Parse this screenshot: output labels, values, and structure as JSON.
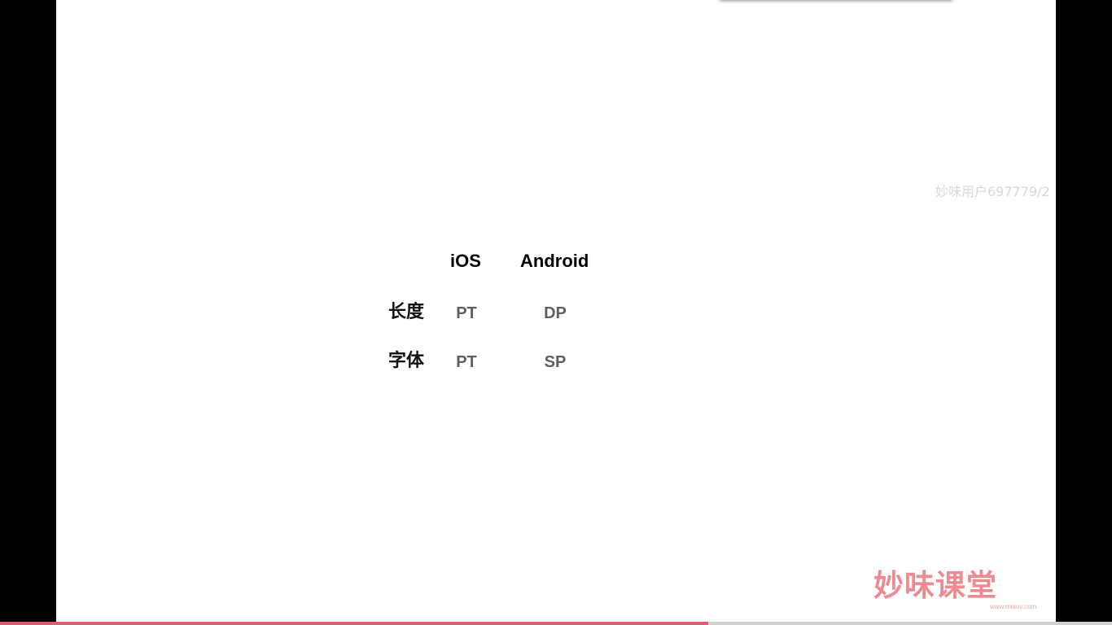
{
  "table": {
    "headers": [
      "iOS",
      "Android"
    ],
    "rows": [
      {
        "label": "长度",
        "ios": "PT",
        "android": "DP"
      },
      {
        "label": "字体",
        "ios": "PT",
        "android": "SP"
      }
    ]
  },
  "watermark": {
    "text": "妙味用户697779/2"
  },
  "logo": {
    "text": "妙味课堂",
    "url": "www.miaov.com"
  },
  "progress": {
    "value": 0.637
  },
  "colors": {
    "progress_fill": "#e05b76",
    "logo": "#ec8c92",
    "cell_text": "#5f5f5f"
  }
}
